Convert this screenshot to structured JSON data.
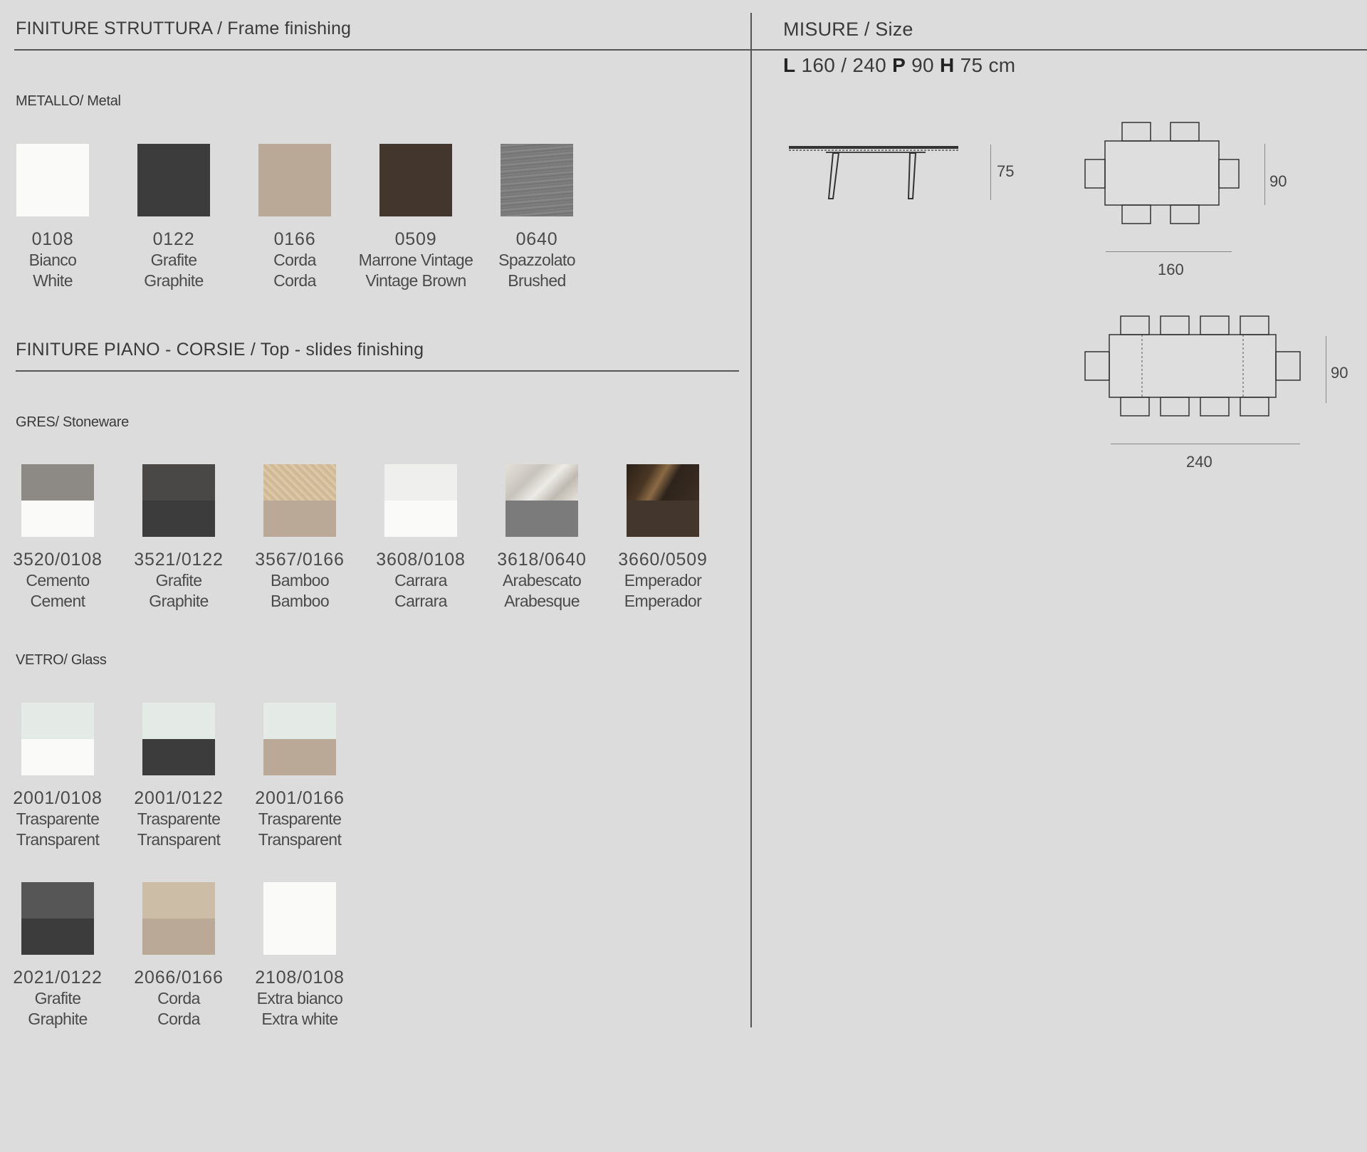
{
  "frame": {
    "heading": "FINITURE STRUTTURA / Frame finishing",
    "metal_label": "METALLO/ Metal",
    "metal": [
      {
        "code": "0108",
        "it": "Bianco",
        "en": "White",
        "top": "#fafaf8",
        "bottom": "#fafaf8"
      },
      {
        "code": "0122",
        "it": "Grafite",
        "en": "Graphite",
        "top": "#3c3c3c",
        "bottom": "#3c3c3c"
      },
      {
        "code": "0166",
        "it": "Corda",
        "en": "Corda",
        "top": "#bba998",
        "bottom": "#bba998"
      },
      {
        "code": "0509",
        "it": "Marrone Vintage",
        "en": "Vintage Brown",
        "top": "#43362c",
        "bottom": "#43362c"
      },
      {
        "code": "0640",
        "it": "Spazzolato",
        "en": "Brushed",
        "top": "#7b7b7b",
        "bottom": "#7b7b7b",
        "texture": "brushed"
      }
    ]
  },
  "top": {
    "heading": "FINITURE PIANO - CORSIE / Top - slides finishing",
    "gres_label": "GRES/ Stoneware",
    "gres": [
      {
        "code": "3520/0108",
        "it": "Cemento",
        "en": "Cement",
        "top": "#8d8a86",
        "bottom": "#fafaf8"
      },
      {
        "code": "3521/0122",
        "it": "Grafite",
        "en": "Graphite",
        "top": "#4a4846",
        "bottom": "#3c3c3c"
      },
      {
        "code": "3567/0166",
        "it": "Bamboo",
        "en": "Bamboo",
        "top": "#d6c2a0",
        "bottom": "#bba998",
        "texture": "bamboo"
      },
      {
        "code": "3608/0108",
        "it": "Carrara",
        "en": "Carrara",
        "top": "#efefed",
        "bottom": "#fafaf8"
      },
      {
        "code": "3618/0640",
        "it": "Arabescato",
        "en": "Arabesque",
        "top": "#d8d4cd",
        "bottom": "#7b7b7b",
        "texture": "marble"
      },
      {
        "code": "3660/0509",
        "it": "Emperador",
        "en": "Emperador",
        "top": "#2e241c",
        "bottom": "#43362c",
        "texture": "emperador"
      }
    ],
    "glass_label": "VETRO/ Glass",
    "glass": [
      {
        "code": "2001/0108",
        "it": "Trasparente",
        "en": "Transparent",
        "top": "#e4ebe7",
        "bottom": "#fafaf8"
      },
      {
        "code": "2001/0122",
        "it": "Trasparente",
        "en": "Transparent",
        "top": "#e4ebe7",
        "bottom": "#3c3c3c"
      },
      {
        "code": "2001/0166",
        "it": "Trasparente",
        "en": "Transparent",
        "top": "#e4ebe7",
        "bottom": "#bba998"
      },
      {
        "code": "2021/0122",
        "it": "Grafite",
        "en": "Graphite",
        "top": "#565656",
        "bottom": "#3c3c3c"
      },
      {
        "code": "2066/0166",
        "it": "Corda",
        "en": "Corda",
        "top": "#cbbda6",
        "bottom": "#bba998"
      },
      {
        "code": "2108/0108",
        "it": "Extra bianco",
        "en": "Extra white",
        "top": "#fafaf9",
        "bottom": "#fafaf9"
      }
    ]
  },
  "size": {
    "heading": "MISURE / Size",
    "L_key": "L",
    "L_val": "160 / 240",
    "P_key": "P",
    "P_val": "90",
    "H_key": "H",
    "H_val": "75 cm",
    "height_dim": "75",
    "small_width_dim": "90",
    "small_length_dim": "160",
    "large_width_dim": "90",
    "large_length_dim": "240"
  }
}
